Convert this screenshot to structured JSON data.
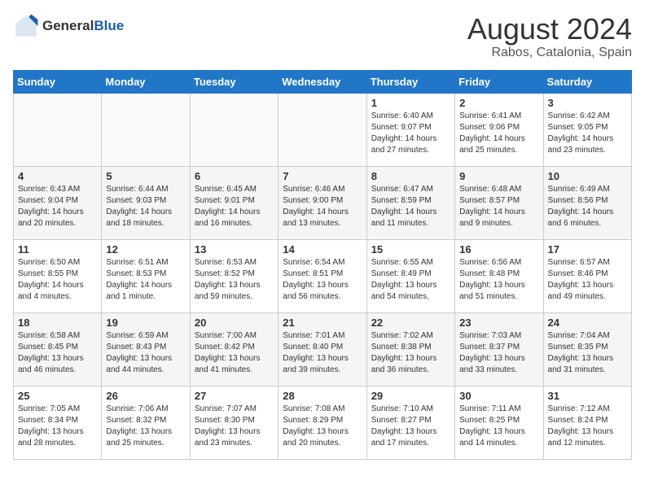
{
  "header": {
    "logo_general": "General",
    "logo_blue": "Blue",
    "month_year": "August 2024",
    "location": "Rabos, Catalonia, Spain"
  },
  "calendar": {
    "days_of_week": [
      "Sunday",
      "Monday",
      "Tuesday",
      "Wednesday",
      "Thursday",
      "Friday",
      "Saturday"
    ],
    "weeks": [
      {
        "row_class": "row-white",
        "days": [
          {
            "number": "",
            "info": "",
            "empty": true
          },
          {
            "number": "",
            "info": "",
            "empty": true
          },
          {
            "number": "",
            "info": "",
            "empty": true
          },
          {
            "number": "",
            "info": "",
            "empty": true
          },
          {
            "number": "1",
            "info": "Sunrise: 6:40 AM\nSunset: 9:07 PM\nDaylight: 14 hours\nand 27 minutes.",
            "empty": false
          },
          {
            "number": "2",
            "info": "Sunrise: 6:41 AM\nSunset: 9:06 PM\nDaylight: 14 hours\nand 25 minutes.",
            "empty": false
          },
          {
            "number": "3",
            "info": "Sunrise: 6:42 AM\nSunset: 9:05 PM\nDaylight: 14 hours\nand 23 minutes.",
            "empty": false
          }
        ]
      },
      {
        "row_class": "row-gray",
        "days": [
          {
            "number": "4",
            "info": "Sunrise: 6:43 AM\nSunset: 9:04 PM\nDaylight: 14 hours\nand 20 minutes.",
            "empty": false
          },
          {
            "number": "5",
            "info": "Sunrise: 6:44 AM\nSunset: 9:03 PM\nDaylight: 14 hours\nand 18 minutes.",
            "empty": false
          },
          {
            "number": "6",
            "info": "Sunrise: 6:45 AM\nSunset: 9:01 PM\nDaylight: 14 hours\nand 16 minutes.",
            "empty": false
          },
          {
            "number": "7",
            "info": "Sunrise: 6:46 AM\nSunset: 9:00 PM\nDaylight: 14 hours\nand 13 minutes.",
            "empty": false
          },
          {
            "number": "8",
            "info": "Sunrise: 6:47 AM\nSunset: 8:59 PM\nDaylight: 14 hours\nand 11 minutes.",
            "empty": false
          },
          {
            "number": "9",
            "info": "Sunrise: 6:48 AM\nSunset: 8:57 PM\nDaylight: 14 hours\nand 9 minutes.",
            "empty": false
          },
          {
            "number": "10",
            "info": "Sunrise: 6:49 AM\nSunset: 8:56 PM\nDaylight: 14 hours\nand 6 minutes.",
            "empty": false
          }
        ]
      },
      {
        "row_class": "row-white",
        "days": [
          {
            "number": "11",
            "info": "Sunrise: 6:50 AM\nSunset: 8:55 PM\nDaylight: 14 hours\nand 4 minutes.",
            "empty": false
          },
          {
            "number": "12",
            "info": "Sunrise: 6:51 AM\nSunset: 8:53 PM\nDaylight: 14 hours\nand 1 minute.",
            "empty": false
          },
          {
            "number": "13",
            "info": "Sunrise: 6:53 AM\nSunset: 8:52 PM\nDaylight: 13 hours\nand 59 minutes.",
            "empty": false
          },
          {
            "number": "14",
            "info": "Sunrise: 6:54 AM\nSunset: 8:51 PM\nDaylight: 13 hours\nand 56 minutes.",
            "empty": false
          },
          {
            "number": "15",
            "info": "Sunrise: 6:55 AM\nSunset: 8:49 PM\nDaylight: 13 hours\nand 54 minutes.",
            "empty": false
          },
          {
            "number": "16",
            "info": "Sunrise: 6:56 AM\nSunset: 8:48 PM\nDaylight: 13 hours\nand 51 minutes.",
            "empty": false
          },
          {
            "number": "17",
            "info": "Sunrise: 6:57 AM\nSunset: 8:46 PM\nDaylight: 13 hours\nand 49 minutes.",
            "empty": false
          }
        ]
      },
      {
        "row_class": "row-gray",
        "days": [
          {
            "number": "18",
            "info": "Sunrise: 6:58 AM\nSunset: 8:45 PM\nDaylight: 13 hours\nand 46 minutes.",
            "empty": false
          },
          {
            "number": "19",
            "info": "Sunrise: 6:59 AM\nSunset: 8:43 PM\nDaylight: 13 hours\nand 44 minutes.",
            "empty": false
          },
          {
            "number": "20",
            "info": "Sunrise: 7:00 AM\nSunset: 8:42 PM\nDaylight: 13 hours\nand 41 minutes.",
            "empty": false
          },
          {
            "number": "21",
            "info": "Sunrise: 7:01 AM\nSunset: 8:40 PM\nDaylight: 13 hours\nand 39 minutes.",
            "empty": false
          },
          {
            "number": "22",
            "info": "Sunrise: 7:02 AM\nSunset: 8:38 PM\nDaylight: 13 hours\nand 36 minutes.",
            "empty": false
          },
          {
            "number": "23",
            "info": "Sunrise: 7:03 AM\nSunset: 8:37 PM\nDaylight: 13 hours\nand 33 minutes.",
            "empty": false
          },
          {
            "number": "24",
            "info": "Sunrise: 7:04 AM\nSunset: 8:35 PM\nDaylight: 13 hours\nand 31 minutes.",
            "empty": false
          }
        ]
      },
      {
        "row_class": "row-white",
        "days": [
          {
            "number": "25",
            "info": "Sunrise: 7:05 AM\nSunset: 8:34 PM\nDaylight: 13 hours\nand 28 minutes.",
            "empty": false
          },
          {
            "number": "26",
            "info": "Sunrise: 7:06 AM\nSunset: 8:32 PM\nDaylight: 13 hours\nand 25 minutes.",
            "empty": false
          },
          {
            "number": "27",
            "info": "Sunrise: 7:07 AM\nSunset: 8:30 PM\nDaylight: 13 hours\nand 23 minutes.",
            "empty": false
          },
          {
            "number": "28",
            "info": "Sunrise: 7:08 AM\nSunset: 8:29 PM\nDaylight: 13 hours\nand 20 minutes.",
            "empty": false
          },
          {
            "number": "29",
            "info": "Sunrise: 7:10 AM\nSunset: 8:27 PM\nDaylight: 13 hours\nand 17 minutes.",
            "empty": false
          },
          {
            "number": "30",
            "info": "Sunrise: 7:11 AM\nSunset: 8:25 PM\nDaylight: 13 hours\nand 14 minutes.",
            "empty": false
          },
          {
            "number": "31",
            "info": "Sunrise: 7:12 AM\nSunset: 8:24 PM\nDaylight: 13 hours\nand 12 minutes.",
            "empty": false
          }
        ]
      }
    ]
  }
}
